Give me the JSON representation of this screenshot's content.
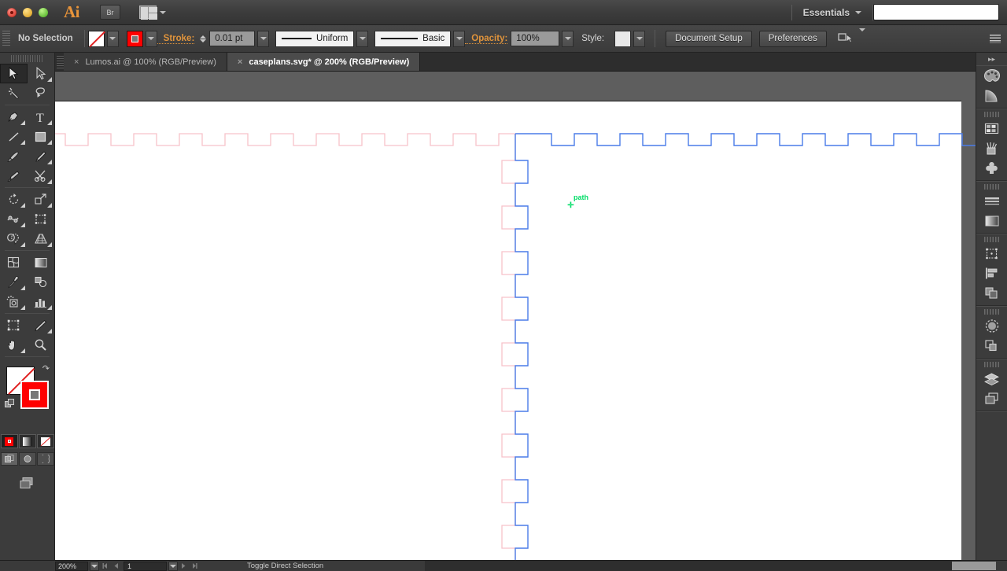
{
  "titlebar": {
    "app_logo": "Ai",
    "bridge_label": "Br",
    "arrange_icon": "arrange-documents-icon",
    "workspace_label": "Essentials",
    "traffic_lights": [
      "close-button",
      "minimize-button",
      "zoom-button"
    ],
    "search_placeholder": ""
  },
  "controlbar": {
    "selection_status": "No Selection",
    "fill_swatch": "none-fill-swatch",
    "stroke_swatch": "red-stroke-swatch",
    "stroke_label": "Stroke:",
    "stroke_weight": "0.01 pt",
    "profile_label": "Uniform",
    "brush_label": "Basic",
    "opacity_label": "Opacity:",
    "opacity_value": "100%",
    "style_label": "Style:",
    "document_setup_label": "Document Setup",
    "preferences_label": "Preferences",
    "select_similar_icon": "select-similar-objects-icon",
    "panel_menu_icon": "panel-menu-icon"
  },
  "tabs": [
    {
      "title": "Lumos.ai @ 100% (RGB/Preview)",
      "active": false,
      "close": "×"
    },
    {
      "title": "caseplans.svg* @ 200% (RGB/Preview)",
      "active": true,
      "close": "×"
    }
  ],
  "toolbar": {
    "tools": [
      {
        "name": "selection-tool",
        "selected": true,
        "flyout": false
      },
      {
        "name": "direct-selection-tool",
        "selected": false,
        "flyout": true
      },
      {
        "name": "magic-wand-tool",
        "selected": false,
        "flyout": false
      },
      {
        "name": "lasso-tool",
        "selected": false,
        "flyout": false
      },
      {
        "name": "pen-tool",
        "selected": false,
        "flyout": true
      },
      {
        "name": "type-tool",
        "selected": false,
        "flyout": true
      },
      {
        "name": "line-segment-tool",
        "selected": false,
        "flyout": true
      },
      {
        "name": "rectangle-tool",
        "selected": false,
        "flyout": true
      },
      {
        "name": "paintbrush-tool",
        "selected": false,
        "flyout": false
      },
      {
        "name": "pencil-tool",
        "selected": false,
        "flyout": true
      },
      {
        "name": "blob-brush-tool",
        "selected": false,
        "flyout": false
      },
      {
        "name": "eraser-scissors-tool",
        "selected": false,
        "flyout": true
      },
      {
        "name": "rotate-tool",
        "selected": false,
        "flyout": true
      },
      {
        "name": "scale-tool",
        "selected": false,
        "flyout": true
      },
      {
        "name": "width-warp-tool",
        "selected": false,
        "flyout": true
      },
      {
        "name": "free-transform-tool",
        "selected": false,
        "flyout": false
      },
      {
        "name": "shape-builder-tool",
        "selected": false,
        "flyout": true
      },
      {
        "name": "perspective-grid-tool",
        "selected": false,
        "flyout": true
      },
      {
        "name": "mesh-tool",
        "selected": false,
        "flyout": false
      },
      {
        "name": "gradient-tool",
        "selected": false,
        "flyout": false
      },
      {
        "name": "eyedropper-tool",
        "selected": false,
        "flyout": true
      },
      {
        "name": "blend-tool",
        "selected": false,
        "flyout": false
      },
      {
        "name": "symbol-sprayer-tool",
        "selected": false,
        "flyout": true
      },
      {
        "name": "column-graph-tool",
        "selected": false,
        "flyout": true
      },
      {
        "name": "artboard-tool",
        "selected": false,
        "flyout": false
      },
      {
        "name": "slice-tool",
        "selected": false,
        "flyout": true
      },
      {
        "name": "hand-tool",
        "selected": false,
        "flyout": true
      },
      {
        "name": "zoom-tool",
        "selected": false,
        "flyout": false
      }
    ],
    "fill_swatch": "none-fill-swatch",
    "stroke_swatch": "red-stroke-swatch",
    "swap_icon": "swap-fill-stroke-icon",
    "default_icon": "default-fill-stroke-icon",
    "color_modes": [
      "color-mode-button",
      "gradient-mode-button",
      "none-mode-button"
    ],
    "draw_modes": [
      "draw-normal-button",
      "draw-behind-button",
      "draw-inside-button"
    ],
    "screen_mode": "change-screen-mode-button"
  },
  "dock": {
    "collapse_icon": "expand-panels-icon",
    "groups": [
      {
        "icons": [
          "color-panel-icon",
          "gradient-panel-icon"
        ]
      },
      {
        "icons": [
          "swatches-panel-icon",
          "brushes-panel-icon",
          "symbols-panel-icon"
        ]
      },
      {
        "icons": [
          "stroke-panel-icon",
          "gradient-fill-panel-icon"
        ]
      },
      {
        "icons": [
          "transform-panel-icon",
          "align-panel-icon",
          "pathfinder-panel-icon"
        ]
      },
      {
        "icons": [
          "transparency-panel-icon",
          "appearance-panel-icon"
        ]
      },
      {
        "icons": [
          "layers-panel-icon",
          "artboards-panel-icon"
        ]
      }
    ]
  },
  "canvas": {
    "smart_guide_label": "path",
    "cursor_glyph": "✛",
    "colors": {
      "unselected_path": "#f8c2ca",
      "selected_path": "#4a7ce8",
      "smart_guide": "#00dd66",
      "artboard": "#ffffff",
      "pasteboard": "#5e5e5e"
    }
  },
  "statusbar": {
    "zoom_value": "200%",
    "page_value": "1",
    "status_text": "Toggle Direct Selection",
    "first_page_icon": "first-page-icon",
    "prev_page_icon": "previous-page-icon",
    "next_page_icon": "next-page-icon",
    "last_page_icon": "last-page-icon"
  },
  "scrollbars": {
    "vertical_up_icon": "scroll-up-arrow",
    "horizontal_left_icon": "scroll-left-arrow",
    "horizontal_right_icon": "scroll-right-arrow"
  }
}
